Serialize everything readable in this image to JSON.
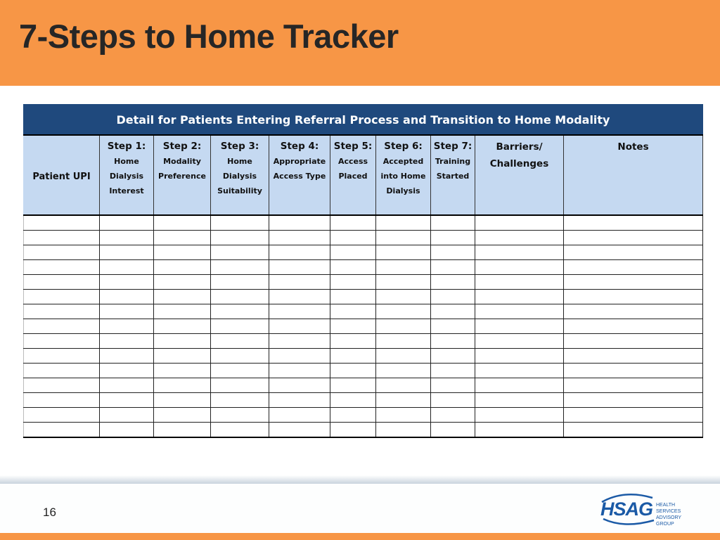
{
  "slide": {
    "title": "7-Steps to Home Tracker",
    "page_number": "16",
    "colors": {
      "accent_orange": "#f79646",
      "banner_navy": "#1f497d",
      "header_blue": "#c5d9f1",
      "logo_blue": "#1b5aa6"
    }
  },
  "table": {
    "banner": "Detail for Patients Entering Referral Process  and Transition to Home Modality",
    "columns": [
      {
        "step": "",
        "label": "Patient UPI"
      },
      {
        "step": "Step 1:",
        "label": "Home Dialysis Interest"
      },
      {
        "step": "Step 2:",
        "label": "Modality Preference"
      },
      {
        "step": "Step 3:",
        "label": "Home Dialysis Suitability"
      },
      {
        "step": "Step 4:",
        "label": "Appropriate Access Type"
      },
      {
        "step": "Step 5:",
        "label": "Access Placed"
      },
      {
        "step": "Step 6:",
        "label": "Accepted into Home Dialysis"
      },
      {
        "step": "Step 7:",
        "label": "Training Started"
      },
      {
        "step": "",
        "label": "Barriers/ Challenges"
      },
      {
        "step": "",
        "label": "Notes"
      }
    ],
    "rows": [
      [
        "",
        "",
        "",
        "",
        "",
        "",
        "",
        "",
        "",
        ""
      ],
      [
        "",
        "",
        "",
        "",
        "",
        "",
        "",
        "",
        "",
        ""
      ],
      [
        "",
        "",
        "",
        "",
        "",
        "",
        "",
        "",
        "",
        ""
      ],
      [
        "",
        "",
        "",
        "",
        "",
        "",
        "",
        "",
        "",
        ""
      ],
      [
        "",
        "",
        "",
        "",
        "",
        "",
        "",
        "",
        "",
        ""
      ],
      [
        "",
        "",
        "",
        "",
        "",
        "",
        "",
        "",
        "",
        ""
      ],
      [
        "",
        "",
        "",
        "",
        "",
        "",
        "",
        "",
        "",
        ""
      ],
      [
        "",
        "",
        "",
        "",
        "",
        "",
        "",
        "",
        "",
        ""
      ],
      [
        "",
        "",
        "",
        "",
        "",
        "",
        "",
        "",
        "",
        ""
      ],
      [
        "",
        "",
        "",
        "",
        "",
        "",
        "",
        "",
        "",
        ""
      ],
      [
        "",
        "",
        "",
        "",
        "",
        "",
        "",
        "",
        "",
        ""
      ],
      [
        "",
        "",
        "",
        "",
        "",
        "",
        "",
        "",
        "",
        ""
      ],
      [
        "",
        "",
        "",
        "",
        "",
        "",
        "",
        "",
        "",
        ""
      ],
      [
        "",
        "",
        "",
        "",
        "",
        "",
        "",
        "",
        "",
        ""
      ],
      [
        "",
        "",
        "",
        "",
        "",
        "",
        "",
        "",
        "",
        ""
      ]
    ]
  },
  "logo": {
    "name": "HSAG",
    "subtitle_line1": "HEALTH SERVICES",
    "subtitle_line2": "ADVISORY GROUP"
  }
}
